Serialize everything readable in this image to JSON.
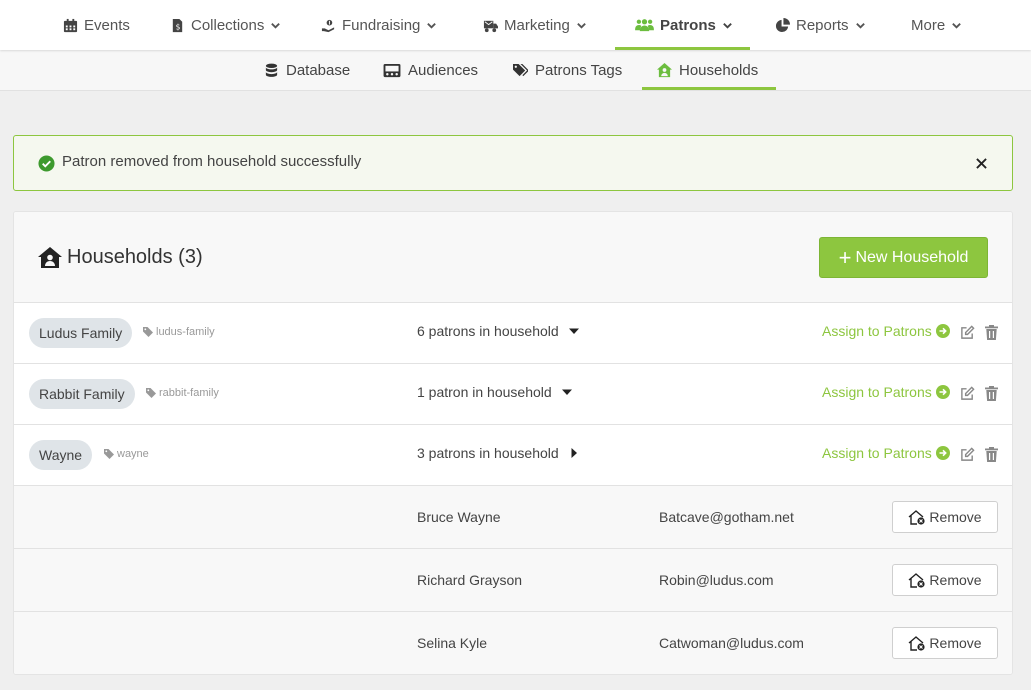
{
  "topnav": {
    "items": [
      {
        "label": "Events",
        "icon": "calendar-icon",
        "dropdown": false
      },
      {
        "label": "Collections",
        "icon": "receipt-icon",
        "dropdown": true
      },
      {
        "label": "Fundraising",
        "icon": "hand-donate-icon",
        "dropdown": true
      },
      {
        "label": "Marketing",
        "icon": "mail-truck-icon",
        "dropdown": true
      },
      {
        "label": "Patrons",
        "icon": "users-icon",
        "dropdown": true,
        "active": true
      },
      {
        "label": "Reports",
        "icon": "pie-chart-icon",
        "dropdown": true
      },
      {
        "label": "More",
        "icon": "",
        "dropdown": true
      }
    ]
  },
  "subnav": {
    "items": [
      {
        "label": "Database",
        "icon": "database-icon"
      },
      {
        "label": "Audiences",
        "icon": "audience-icon"
      },
      {
        "label": "Patrons Tags",
        "icon": "tags-icon"
      },
      {
        "label": "Households",
        "icon": "house-user-icon",
        "active": true
      }
    ]
  },
  "alert": {
    "message": "Patron removed from household successfully",
    "type": "success"
  },
  "card": {
    "title": "Households (3)",
    "new_button_label": "New Household",
    "new_button_plus": "+"
  },
  "households": [
    {
      "name": "Ludus Family",
      "slug": "ludus-family",
      "count_label": "6 patrons in household",
      "expanded": false,
      "assign_label": "Assign to Patrons"
    },
    {
      "name": "Rabbit Family",
      "slug": "rabbit-family",
      "count_label": "1 patron in household",
      "expanded": false,
      "assign_label": "Assign to Patrons"
    },
    {
      "name": "Wayne",
      "slug": "wayne",
      "count_label": "3 patrons in household",
      "expanded": true,
      "assign_label": "Assign to Patrons"
    }
  ],
  "members": [
    {
      "name": "Bruce Wayne",
      "email": "Batcave@gotham.net",
      "remove_label": "Remove"
    },
    {
      "name": "Richard Grayson",
      "email": "Robin@ludus.com",
      "remove_label": "Remove"
    },
    {
      "name": "Selina Kyle",
      "email": "Catwoman@ludus.com",
      "remove_label": "Remove"
    }
  ],
  "colors": {
    "accent": "#8dc63f",
    "pill": "#dfe4e8",
    "alert_bg": "#f5f8ef"
  }
}
